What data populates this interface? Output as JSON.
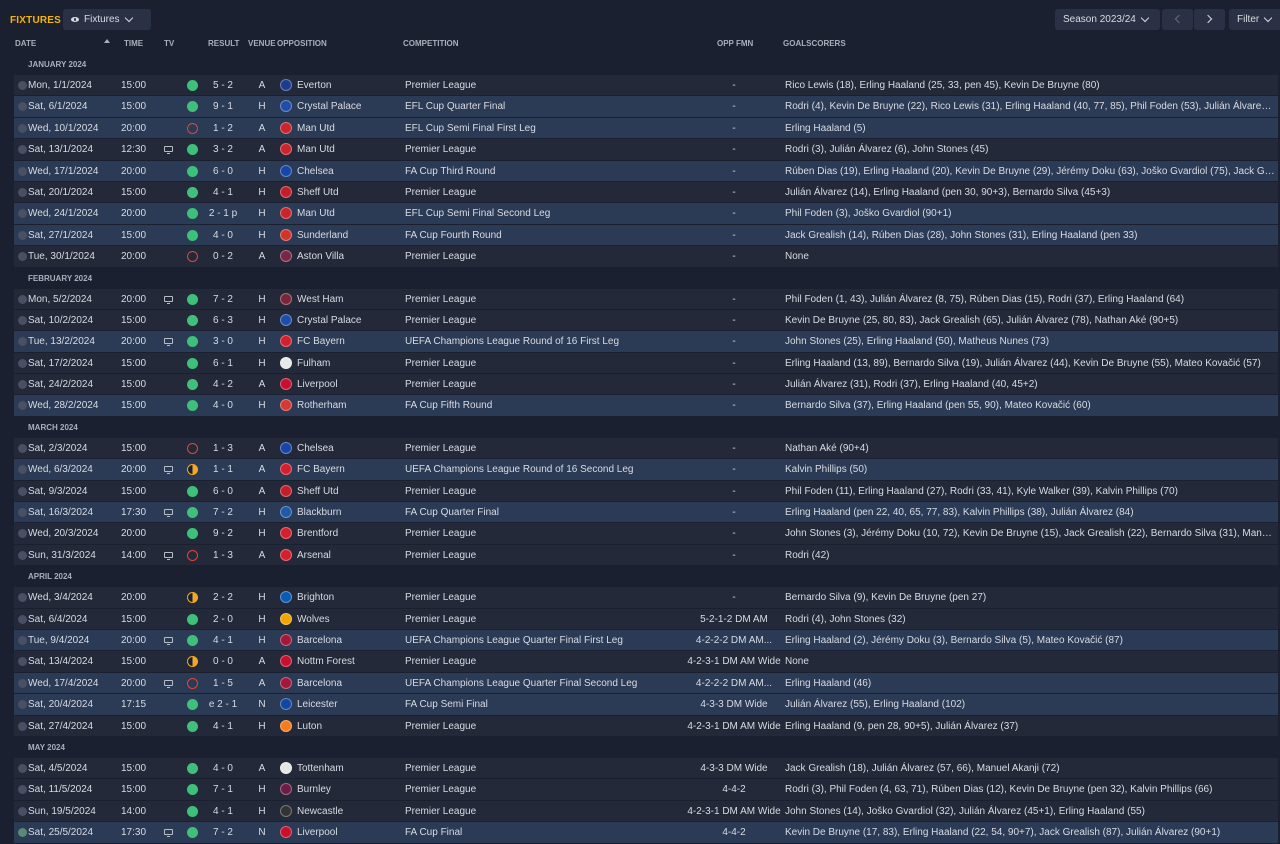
{
  "page_title": "FIXTURES",
  "view_dropdown": "Fixtures",
  "season_dropdown": "Season 2023/24",
  "filter_label": "Filter",
  "columns": {
    "date": "DATE",
    "time": "TIME",
    "tv": "TV",
    "result": "RESULT",
    "venue": "VENUE",
    "opposition": "OPPOSITION",
    "competition": "COMPETITION",
    "opp_fmn": "OPP FMN",
    "goalscorers": "GOALSCORERS"
  },
  "colors": {
    "win": "#3fc07a",
    "loss": "#e0463c",
    "draw": "#f0a927",
    "accent": "#f5b400"
  },
  "months": [
    {
      "label": "JANUARY 2024",
      "fixtures": [
        {
          "date": "Mon, 1/1/2024",
          "time": "15:00",
          "tv": false,
          "res": "w",
          "score": "5 - 2",
          "venue": "A",
          "badge": "#1d3c8f",
          "opp": "Everton",
          "comp": "Premier League",
          "fmn": "-",
          "goals": "Rico Lewis (18), Erling Haaland (25, 33, pen 45), Kevin De Bruyne (80)",
          "hl": false,
          "checked": false
        },
        {
          "date": "Sat, 6/1/2024",
          "time": "15:00",
          "tv": false,
          "res": "w",
          "score": "9 - 1",
          "venue": "H",
          "badge": "#1e4ea8",
          "opp": "Crystal Palace",
          "comp": "EFL Cup Quarter Final",
          "fmn": "-",
          "goals": "Rodri (4), Kevin De Bruyne (22), Rico Lewis (31), Erling Haaland (40, 77, 85), Phil Foden (53), Julián Álvarez (73,...",
          "hl": true,
          "checked": false
        },
        {
          "date": "Wed, 10/1/2024",
          "time": "20:00",
          "tv": false,
          "res": "l",
          "score": "1 - 2",
          "venue": "A",
          "badge": "#c8262b",
          "opp": "Man Utd",
          "comp": "EFL Cup Semi Final First Leg",
          "fmn": "-",
          "goals": "Erling Haaland (5)",
          "hl": true,
          "checked": false
        },
        {
          "date": "Sat, 13/1/2024",
          "time": "12:30",
          "tv": true,
          "res": "w",
          "score": "3 - 2",
          "venue": "A",
          "badge": "#c8262b",
          "opp": "Man Utd",
          "comp": "Premier League",
          "fmn": "-",
          "goals": "Rodri (3), Julián Álvarez (6), John Stones (45)",
          "hl": false,
          "checked": false
        },
        {
          "date": "Wed, 17/1/2024",
          "time": "20:00",
          "tv": false,
          "res": "w",
          "score": "6 - 0",
          "venue": "H",
          "badge": "#1846a8",
          "opp": "Chelsea",
          "comp": "FA Cup Third Round",
          "fmn": "-",
          "goals": "Rúben Dias (19), Erling Haaland (20), Kevin De Bruyne (29), Jérémy Doku (63), Joško Gvardiol (75), Jack Grealis...",
          "hl": true,
          "checked": false
        },
        {
          "date": "Sat, 20/1/2024",
          "time": "15:00",
          "tv": false,
          "res": "w",
          "score": "4 - 1",
          "venue": "H",
          "badge": "#c41e2a",
          "opp": "Sheff Utd",
          "comp": "Premier League",
          "fmn": "-",
          "goals": "Julián Álvarez (14), Erling Haaland (pen 30, 90+3), Bernardo Silva (45+3)",
          "hl": false,
          "checked": false
        },
        {
          "date": "Wed, 24/1/2024",
          "time": "20:00",
          "tv": false,
          "res": "w",
          "score": "2 - 1 p",
          "venue": "H",
          "badge": "#c8262b",
          "opp": "Man Utd",
          "comp": "EFL Cup Semi Final Second Leg",
          "fmn": "-",
          "goals": "Phil Foden (3), Joško Gvardiol (90+1)",
          "hl": true,
          "checked": false
        },
        {
          "date": "Sat, 27/1/2024",
          "time": "15:00",
          "tv": false,
          "res": "w",
          "score": "4 - 0",
          "venue": "H",
          "badge": "#d0352a",
          "opp": "Sunderland",
          "comp": "FA Cup Fourth Round",
          "fmn": "-",
          "goals": "Jack Grealish (14), Rúben Dias (28), John Stones (31), Erling Haaland (pen 33)",
          "hl": true,
          "checked": false
        },
        {
          "date": "Tue, 30/1/2024",
          "time": "20:00",
          "tv": false,
          "res": "l",
          "score": "0 - 2",
          "venue": "A",
          "badge": "#7a2747",
          "opp": "Aston Villa",
          "comp": "Premier League",
          "fmn": "-",
          "goals": "None",
          "hl": false,
          "checked": false
        }
      ]
    },
    {
      "label": "FEBRUARY 2024",
      "fixtures": [
        {
          "date": "Mon, 5/2/2024",
          "time": "20:00",
          "tv": true,
          "res": "w",
          "score": "7 - 2",
          "venue": "H",
          "badge": "#7a263a",
          "opp": "West Ham",
          "comp": "Premier League",
          "fmn": "-",
          "goals": "Phil Foden (1, 43), Julián Álvarez (8, 75), Rúben Dias (15), Rodri (37), Erling Haaland (64)",
          "hl": false,
          "checked": false
        },
        {
          "date": "Sat, 10/2/2024",
          "time": "15:00",
          "tv": false,
          "res": "w",
          "score": "6 - 3",
          "venue": "H",
          "badge": "#1e4ea8",
          "opp": "Crystal Palace",
          "comp": "Premier League",
          "fmn": "-",
          "goals": "Kevin De Bruyne (25, 80, 83), Jack Grealish (65), Julián Álvarez (78), Nathan Aké (90+5)",
          "hl": false,
          "checked": false
        },
        {
          "date": "Tue, 13/2/2024",
          "time": "20:00",
          "tv": true,
          "res": "w",
          "score": "3 - 0",
          "venue": "H",
          "badge": "#d4202e",
          "opp": "FC Bayern",
          "comp": "UEFA Champions League Round of 16 First Leg",
          "fmn": "-",
          "goals": "John Stones (25), Erling Haaland (50), Matheus Nunes (73)",
          "hl": true,
          "checked": false
        },
        {
          "date": "Sat, 17/2/2024",
          "time": "15:00",
          "tv": false,
          "res": "w",
          "score": "6 - 1",
          "venue": "H",
          "badge": "#e8e8e8",
          "opp": "Fulham",
          "comp": "Premier League",
          "fmn": "-",
          "goals": "Erling Haaland (13, 89), Bernardo Silva (19), Julián Álvarez (44), Kevin De Bruyne (55), Mateo Kovačić (57)",
          "hl": false,
          "checked": false
        },
        {
          "date": "Sat, 24/2/2024",
          "time": "15:00",
          "tv": false,
          "res": "w",
          "score": "4 - 2",
          "venue": "A",
          "badge": "#c8102e",
          "opp": "Liverpool",
          "comp": "Premier League",
          "fmn": "-",
          "goals": "Julián Álvarez (31), Rodri (37), Erling Haaland (40, 45+2)",
          "hl": false,
          "checked": false
        },
        {
          "date": "Wed, 28/2/2024",
          "time": "15:00",
          "tv": false,
          "res": "w",
          "score": "4 - 0",
          "venue": "H",
          "badge": "#d23a32",
          "opp": "Rotherham",
          "comp": "FA Cup Fifth Round",
          "fmn": "-",
          "goals": "Bernardo Silva (37), Erling Haaland (pen 55, 90), Mateo Kovačić (60)",
          "hl": true,
          "checked": false
        }
      ]
    },
    {
      "label": "MARCH 2024",
      "fixtures": [
        {
          "date": "Sat, 2/3/2024",
          "time": "15:00",
          "tv": false,
          "res": "l",
          "score": "1 - 3",
          "venue": "A",
          "badge": "#1846a8",
          "opp": "Chelsea",
          "comp": "Premier League",
          "fmn": "-",
          "goals": "Nathan Aké (90+4)",
          "hl": false,
          "checked": false
        },
        {
          "date": "Wed, 6/3/2024",
          "time": "20:00",
          "tv": true,
          "res": "d",
          "score": "1 - 1",
          "venue": "A",
          "badge": "#d4202e",
          "opp": "FC Bayern",
          "comp": "UEFA Champions League Round of 16 Second Leg",
          "fmn": "-",
          "goals": "Kalvin Phillips (50)",
          "hl": true,
          "checked": false
        },
        {
          "date": "Sat, 9/3/2024",
          "time": "15:00",
          "tv": false,
          "res": "w",
          "score": "6 - 0",
          "venue": "A",
          "badge": "#c41e2a",
          "opp": "Sheff Utd",
          "comp": "Premier League",
          "fmn": "-",
          "goals": "Phil Foden (11), Erling Haaland (27), Rodri (33, 41), Kyle Walker (39), Kalvin Phillips (70)",
          "hl": false,
          "checked": false
        },
        {
          "date": "Sat, 16/3/2024",
          "time": "17:30",
          "tv": true,
          "res": "w",
          "score": "7 - 2",
          "venue": "H",
          "badge": "#1f5aa6",
          "opp": "Blackburn",
          "comp": "FA Cup Quarter Final",
          "fmn": "-",
          "goals": "Erling Haaland (pen 22, 40, 65, 77, 83), Kalvin Phillips (38), Julián Álvarez (84)",
          "hl": true,
          "checked": false
        },
        {
          "date": "Wed, 20/3/2024",
          "time": "20:00",
          "tv": false,
          "res": "w",
          "score": "9 - 2",
          "venue": "H",
          "badge": "#d4202e",
          "opp": "Brentford",
          "comp": "Premier League",
          "fmn": "-",
          "goals": "John Stones (3), Jérémy Doku (10, 72), Kevin De Bruyne (15), Jack Grealish (22), Bernardo Silva (31), Manuel Ak...",
          "hl": false,
          "checked": false
        },
        {
          "date": "Sun, 31/3/2024",
          "time": "14:00",
          "tv": true,
          "res": "l",
          "score": "1 - 3",
          "venue": "A",
          "badge": "#d4202e",
          "opp": "Arsenal",
          "comp": "Premier League",
          "fmn": "-",
          "goals": "Rodri (42)",
          "hl": false,
          "checked": false
        }
      ]
    },
    {
      "label": "APRIL 2024",
      "fixtures": [
        {
          "date": "Wed, 3/4/2024",
          "time": "20:00",
          "tv": false,
          "res": "d",
          "score": "2 - 2",
          "venue": "H",
          "badge": "#0a5bb5",
          "opp": "Brighton",
          "comp": "Premier League",
          "fmn": "-",
          "goals": "Bernardo Silva (9), Kevin De Bruyne (pen 27)",
          "hl": false,
          "checked": false
        },
        {
          "date": "Sat, 6/4/2024",
          "time": "15:00",
          "tv": false,
          "res": "w",
          "score": "2 - 0",
          "venue": "H",
          "badge": "#f0a500",
          "opp": "Wolves",
          "comp": "Premier League",
          "fmn": "5-2-1-2 DM AM",
          "goals": "Rodri (4), John Stones (32)",
          "hl": false,
          "checked": false
        },
        {
          "date": "Tue, 9/4/2024",
          "time": "20:00",
          "tv": true,
          "res": "w",
          "score": "4 - 1",
          "venue": "H",
          "badge": "#a3173a",
          "opp": "Barcelona",
          "comp": "UEFA Champions League Quarter Final First Leg",
          "fmn": "4-2-2-2 DM AM...",
          "goals": "Erling Haaland (2), Jérémy Doku (3), Bernardo Silva (5), Mateo Kovačić (87)",
          "hl": true,
          "checked": false
        },
        {
          "date": "Sat, 13/4/2024",
          "time": "15:00",
          "tv": false,
          "res": "d",
          "score": "0 - 0",
          "venue": "A",
          "badge": "#c8102e",
          "opp": "Nottm Forest",
          "comp": "Premier League",
          "fmn": "4-2-3-1 DM AM Wide",
          "goals": "None",
          "hl": false,
          "checked": false
        },
        {
          "date": "Wed, 17/4/2024",
          "time": "20:00",
          "tv": true,
          "res": "l",
          "score": "1 - 5",
          "venue": "A",
          "badge": "#a3173a",
          "opp": "Barcelona",
          "comp": "UEFA Champions League Quarter Final Second Leg",
          "fmn": "4-2-2-2 DM AM...",
          "goals": "Erling Haaland (46)",
          "hl": true,
          "checked": false
        },
        {
          "date": "Sat, 20/4/2024",
          "time": "17:15",
          "tv": false,
          "res": "w",
          "score": "e 2 - 1",
          "venue": "N",
          "badge": "#1346a0",
          "opp": "Leicester",
          "comp": "FA Cup Semi Final",
          "fmn": "4-3-3 DM Wide",
          "goals": "Julián Álvarez (55), Erling Haaland (102)",
          "hl": true,
          "checked": false
        },
        {
          "date": "Sat, 27/4/2024",
          "time": "15:00",
          "tv": false,
          "res": "w",
          "score": "4 - 1",
          "venue": "H",
          "badge": "#f57d20",
          "opp": "Luton",
          "comp": "Premier League",
          "fmn": "4-2-3-1 DM AM Wide",
          "goals": "Erling Haaland (9, pen 28, 90+5), Julián Álvarez (37)",
          "hl": false,
          "checked": false
        }
      ]
    },
    {
      "label": "MAY 2024",
      "fixtures": [
        {
          "date": "Sat, 4/5/2024",
          "time": "15:00",
          "tv": false,
          "res": "w",
          "score": "4 - 0",
          "venue": "A",
          "badge": "#e6e6e6",
          "opp": "Tottenham",
          "comp": "Premier League",
          "fmn": "4-3-3 DM Wide",
          "goals": "Jack Grealish (18), Julián Álvarez (57, 66), Manuel Akanji (72)",
          "hl": false,
          "checked": false
        },
        {
          "date": "Sat, 11/5/2024",
          "time": "15:00",
          "tv": false,
          "res": "w",
          "score": "7 - 1",
          "venue": "H",
          "badge": "#6c1d45",
          "opp": "Burnley",
          "comp": "Premier League",
          "fmn": "4-4-2",
          "goals": "Rodri (3), Phil Foden (4, 63, 71), Rúben Dias (12), Kevin De Bruyne (pen 32), Kalvin Phillips (66)",
          "hl": false,
          "checked": false
        },
        {
          "date": "Sun, 19/5/2024",
          "time": "14:00",
          "tv": false,
          "res": "w",
          "score": "4 - 1",
          "venue": "H",
          "badge": "#333333",
          "opp": "Newcastle",
          "comp": "Premier League",
          "fmn": "4-2-3-1 DM AM Wide",
          "goals": "John Stones (14), Joško Gvardiol (32), Julián Álvarez (45+1), Erling Haaland (55)",
          "hl": false,
          "checked": false
        },
        {
          "date": "Sat, 25/5/2024",
          "time": "17:30",
          "tv": true,
          "res": "w",
          "score": "7 - 2",
          "venue": "N",
          "badge": "#c8102e",
          "opp": "Liverpool",
          "comp": "FA Cup Final",
          "fmn": "4-4-2",
          "goals": "Kevin De Bruyne (17, 83), Erling Haaland (22, 54, 90+7), Jack Grealish (87), Julián Álvarez (90+1)",
          "hl": true,
          "checked": true
        }
      ]
    }
  ]
}
